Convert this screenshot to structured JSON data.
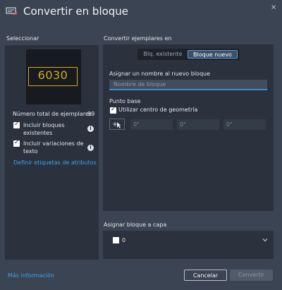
{
  "window": {
    "title": "Convertir en bloque",
    "close_glyph": "×",
    "icon": "convert-block-icon"
  },
  "left": {
    "heading": "Seleccionar",
    "preview_text": "6030",
    "total_label": "Número total de ejemplares",
    "total_value": "99",
    "include_existing": {
      "label_line1": "Incluir bloques",
      "label_line2": "existentes",
      "checked": true
    },
    "include_variations": {
      "label_line1": "Incluir variaciones de",
      "label_line2": "texto",
      "checked": true
    },
    "info_glyph": "i",
    "define_link": "Definir etiquetas de atributos"
  },
  "right": {
    "heading": "Convertir ejemplares en",
    "segment": {
      "option_existing": "Blq. existente",
      "option_new": "Bloque nuevo",
      "selected": "Bloque nuevo"
    },
    "name_label": "Asignar un nombre al nuevo bloque",
    "name_value": "",
    "name_placeholder": "Nombre de bloque",
    "base_point_label": "Punto base",
    "use_geometry_center": {
      "label": "Utilizar centro de geometría",
      "checked": true
    },
    "coords": [
      "0\"",
      "0\"",
      "0\""
    ]
  },
  "layer": {
    "heading": "Asignar bloque a capa",
    "value": "0",
    "swatch_color": "#ffffff"
  },
  "footer": {
    "more_info_link": "Más información",
    "cancel_label": "Cancelar",
    "convert_label": "Convertir"
  },
  "colors": {
    "accent": "#2d8fd5",
    "link": "#3ea4ea",
    "preview_stroke": "#d6a91a"
  }
}
